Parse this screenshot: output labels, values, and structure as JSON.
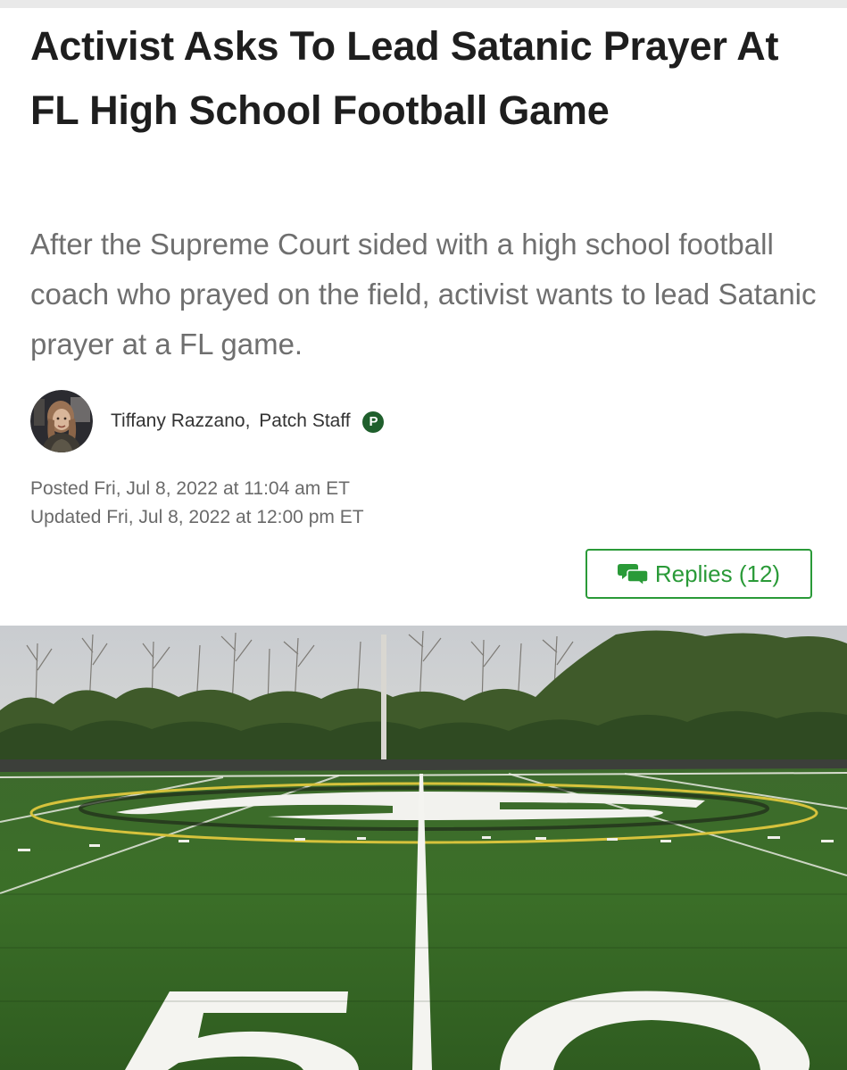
{
  "article": {
    "headline": "Activist Asks To Lead Satanic Prayer At FL High School Football Game",
    "dek": "After the Supreme Court sided with a high school football coach who prayed on the field, activist wants to lead Satanic prayer at a FL game.",
    "author": {
      "name": "Tiffany Razzano",
      "separator": ",",
      "role": "Patch Staff",
      "badge_letter": "P",
      "avatar_icon": "author-avatar-photo"
    },
    "posted": "Posted Fri, Jul 8, 2022 at 11:04 am ET",
    "updated": "Updated Fri, Jul 8, 2022 at 12:00 pm ET"
  },
  "replies_button": {
    "label": "Replies (12)",
    "icon": "speech-bubbles-icon"
  },
  "hero_image": {
    "field_number": "50",
    "description_icon": "football-field-photo"
  },
  "colors": {
    "accent_green": "#2a9a38",
    "badge_green": "#1f5f2c",
    "headline": "#1e1e1e",
    "dek": "#6f6f6f",
    "meta": "#6a6a6a"
  }
}
